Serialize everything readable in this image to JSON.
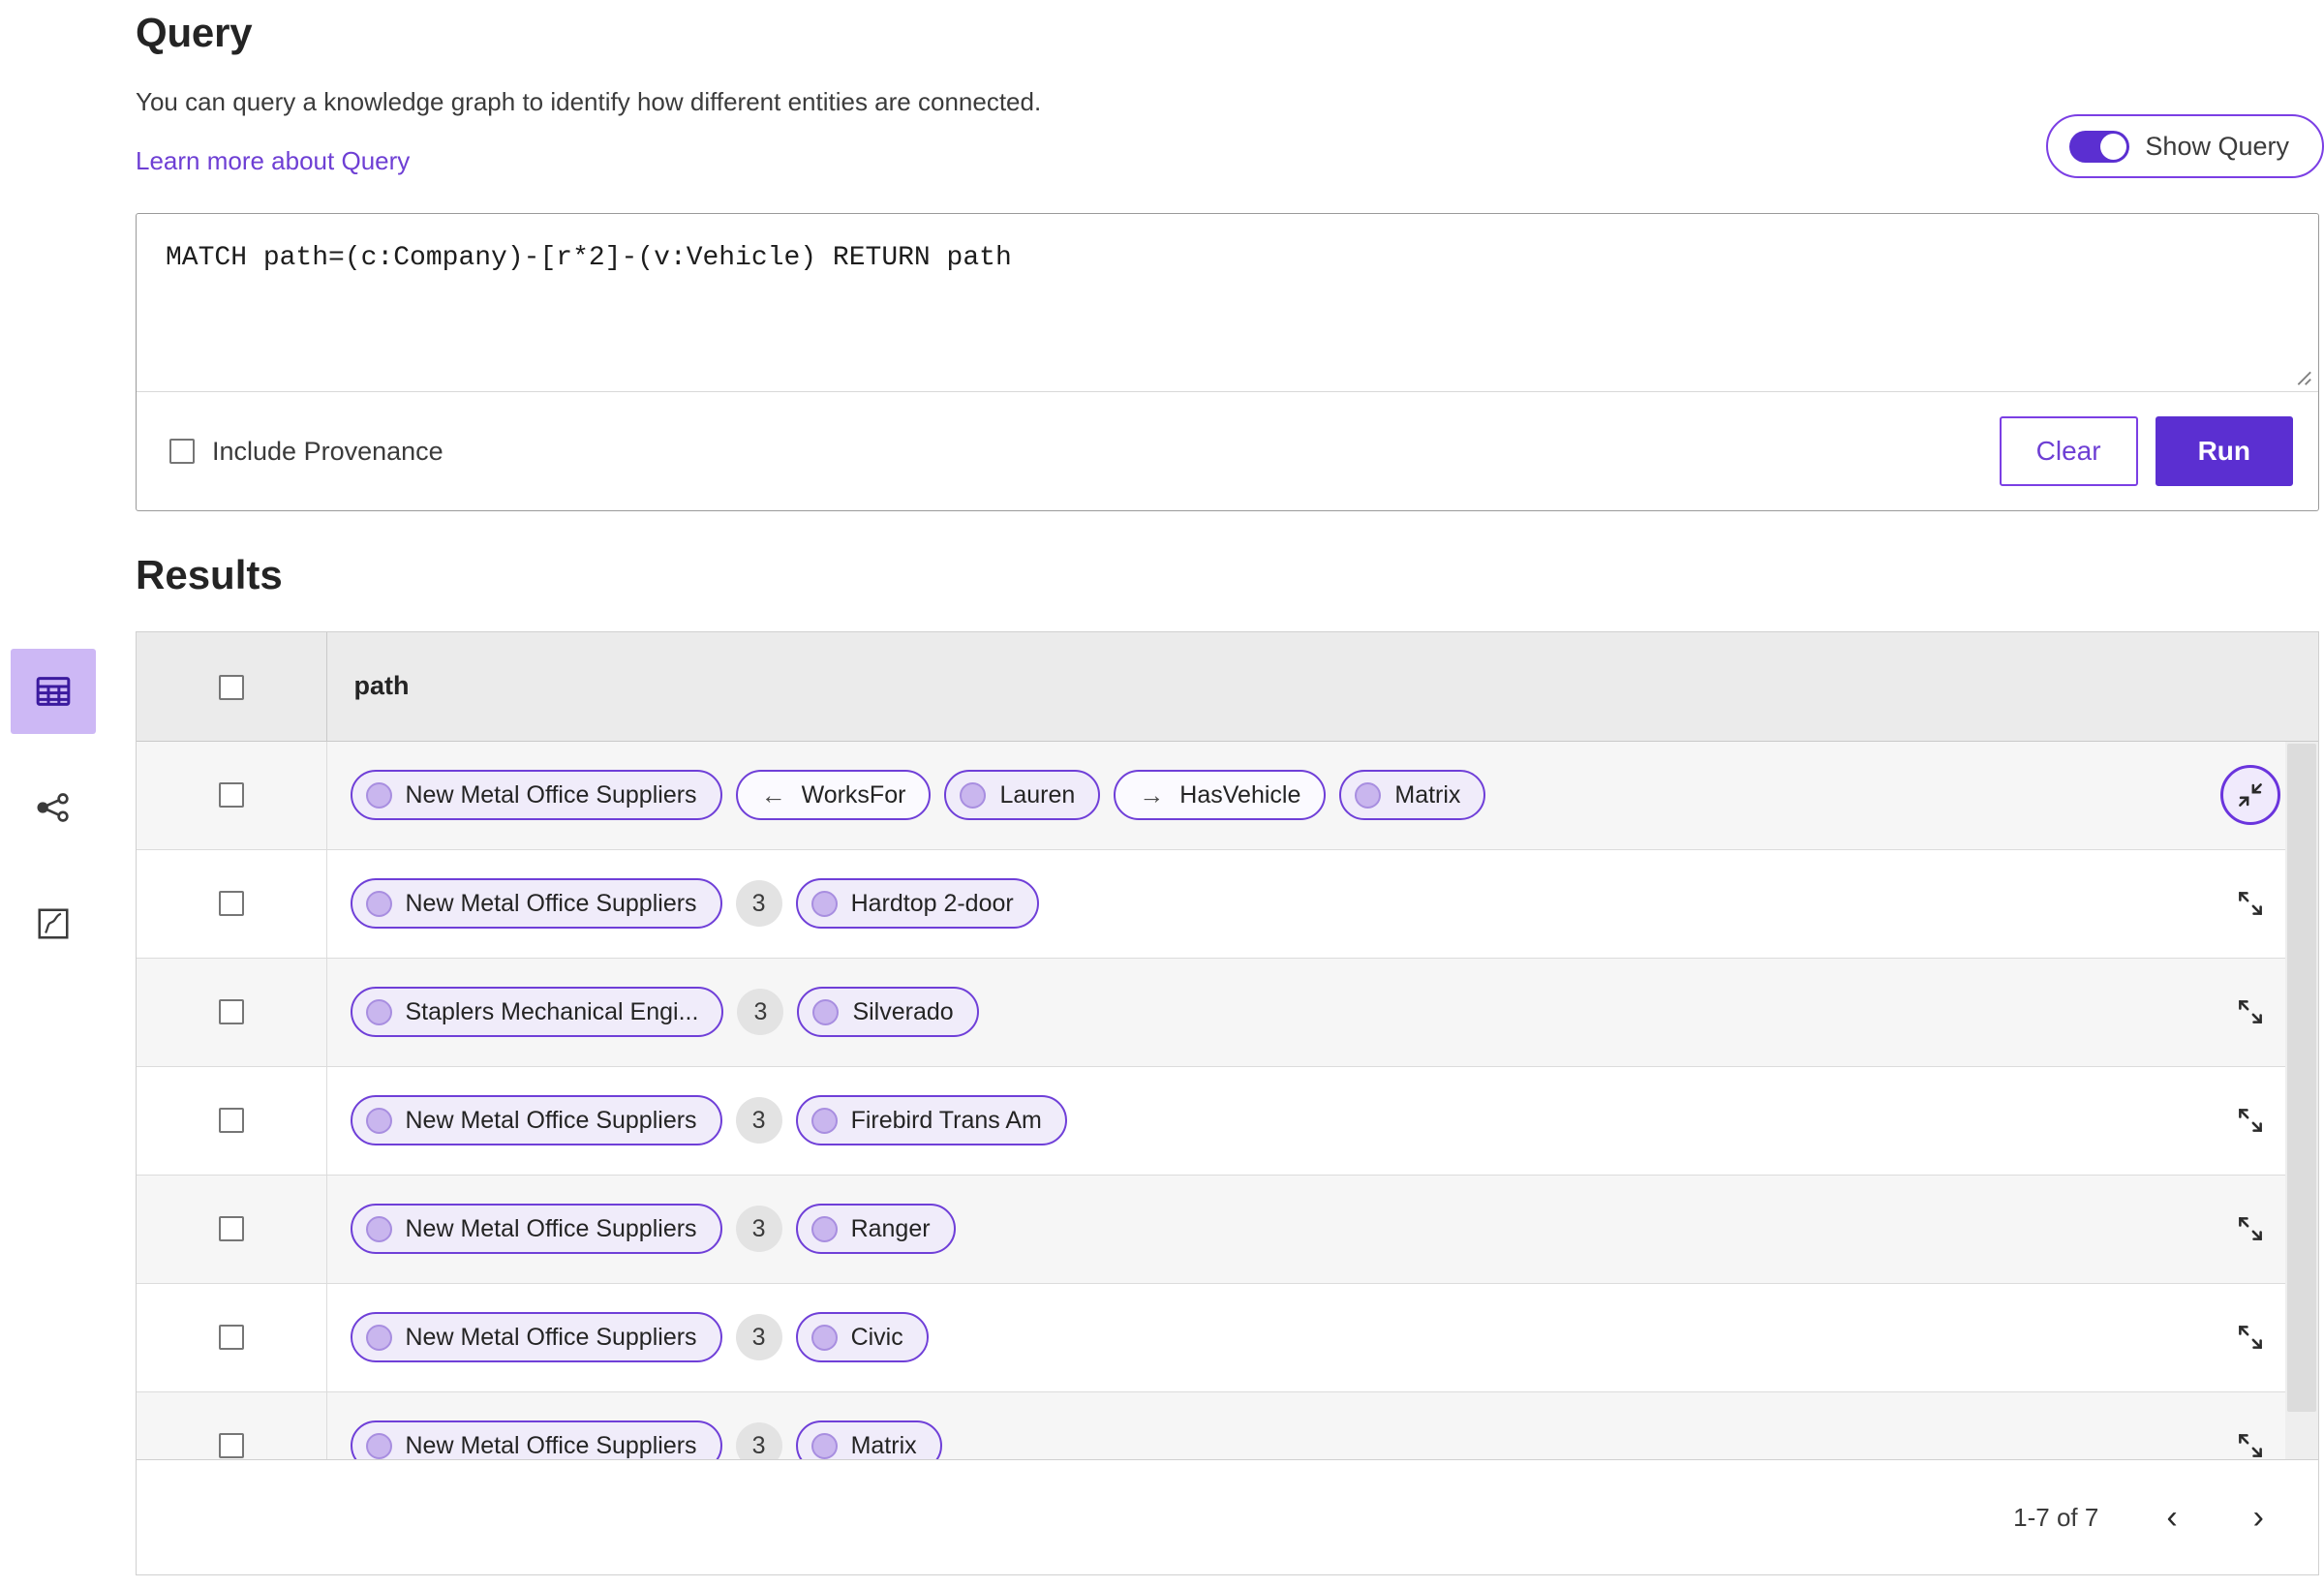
{
  "rail": {
    "items": [
      {
        "name": "table-view",
        "icon": "table-icon",
        "active": true
      },
      {
        "name": "graph-view",
        "icon": "graph-icon",
        "active": false
      },
      {
        "name": "map-view",
        "icon": "map-icon",
        "active": false
      }
    ]
  },
  "query": {
    "title": "Query",
    "description": "You can query a knowledge graph to identify how different entities are connected.",
    "learn_more": "Learn more about Query",
    "toggle": {
      "label": "Show Query",
      "on": true
    },
    "editor_value": "MATCH path=(c:Company)-[r*2]-(v:Vehicle) RETURN path",
    "editor_placeholder": "Enter a query",
    "include_provenance": {
      "label": "Include Provenance",
      "checked": false
    },
    "clear_label": "Clear",
    "run_label": "Run"
  },
  "results": {
    "title": "Results",
    "columns": [
      "path"
    ],
    "pagination": {
      "range": "1-7 of 7",
      "prev": "‹",
      "next": "›"
    },
    "rows": [
      {
        "expanded": true,
        "action_icon": "collapse-icon",
        "items": [
          {
            "kind": "node",
            "label": "New Metal Office Suppliers"
          },
          {
            "kind": "rel",
            "label": "WorksFor",
            "arrow": "←"
          },
          {
            "kind": "node",
            "label": "Lauren"
          },
          {
            "kind": "rel",
            "label": "HasVehicle",
            "arrow": "→"
          },
          {
            "kind": "node",
            "label": "Matrix"
          }
        ]
      },
      {
        "expanded": false,
        "action_icon": "expand-icon",
        "items": [
          {
            "kind": "node",
            "label": "New Metal Office Suppliers"
          },
          {
            "kind": "hops",
            "label": "3"
          },
          {
            "kind": "node",
            "label": "Hardtop 2-door"
          }
        ]
      },
      {
        "expanded": false,
        "action_icon": "expand-icon",
        "items": [
          {
            "kind": "node",
            "label": "Staplers Mechanical Engi..."
          },
          {
            "kind": "hops",
            "label": "3"
          },
          {
            "kind": "node",
            "label": "Silverado"
          }
        ]
      },
      {
        "expanded": false,
        "action_icon": "expand-icon",
        "items": [
          {
            "kind": "node",
            "label": "New Metal Office Suppliers"
          },
          {
            "kind": "hops",
            "label": "3"
          },
          {
            "kind": "node",
            "label": "Firebird Trans Am"
          }
        ]
      },
      {
        "expanded": false,
        "action_icon": "expand-icon",
        "items": [
          {
            "kind": "node",
            "label": "New Metal Office Suppliers"
          },
          {
            "kind": "hops",
            "label": "3"
          },
          {
            "kind": "node",
            "label": "Ranger"
          }
        ]
      },
      {
        "expanded": false,
        "action_icon": "expand-icon",
        "items": [
          {
            "kind": "node",
            "label": "New Metal Office Suppliers"
          },
          {
            "kind": "hops",
            "label": "3"
          },
          {
            "kind": "node",
            "label": "Civic"
          }
        ]
      },
      {
        "expanded": false,
        "action_icon": "expand-icon",
        "items": [
          {
            "kind": "node",
            "label": "New Metal Office Suppliers"
          },
          {
            "kind": "hops",
            "label": "3"
          },
          {
            "kind": "node",
            "label": "Matrix"
          }
        ]
      }
    ]
  },
  "colors": {
    "accent": "#5b2fd1",
    "accent_border": "#7b3fe4",
    "link": "#6e3fd4",
    "chip_node_bg": "#f0ecfa",
    "chip_rel_bg": "#fbfaff",
    "node_dot": "#c9b6ee",
    "hop_badge_bg": "#e3e3e3",
    "rail_active_bg": "#cdb8f5",
    "header_bg": "#ebebeb",
    "row_odd_bg": "#f6f6f6"
  }
}
